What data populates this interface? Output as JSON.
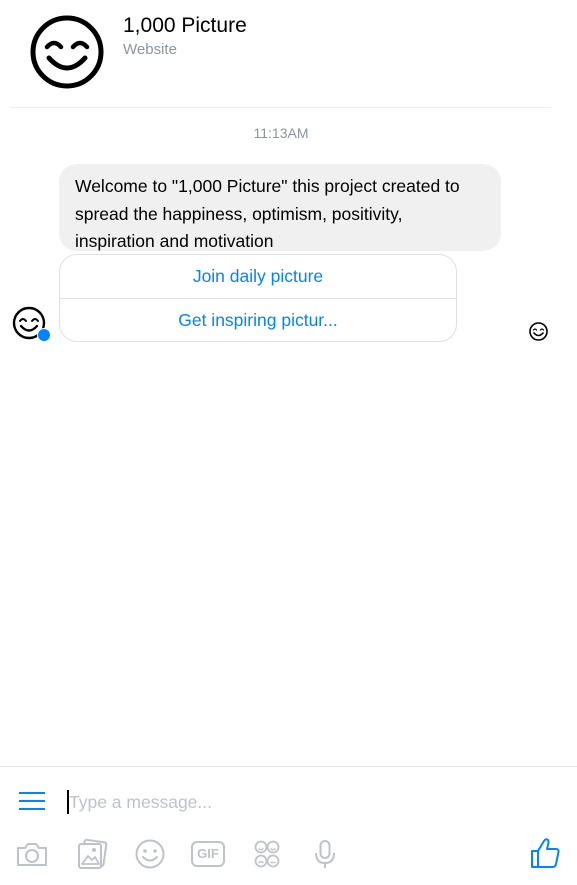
{
  "header": {
    "title": "1,000 Picture",
    "subtitle": "Website",
    "avatar_icon": "smiley-face-icon"
  },
  "conversation": {
    "timestamp": "11:13AM",
    "message": {
      "text": "Welcome to \"1,000 Picture\" this project created to spread the happiness, optimism, positivity, inspiration and motivation"
    },
    "quick_replies": [
      {
        "label": "Join daily picture"
      },
      {
        "label": "Get inspiring pictur..."
      }
    ]
  },
  "composer": {
    "placeholder": "Type a message...",
    "value": "",
    "tools": [
      "camera-icon",
      "gallery-icon",
      "emoji-icon",
      "gif-icon",
      "stickers-icon",
      "microphone-icon"
    ],
    "gif_label": "GIF",
    "send_icon": "thumbs-up-icon"
  },
  "colors": {
    "accent": "#0084ff",
    "bubble": "#f1f0f0",
    "muted_text": "#8d949e",
    "tool_gray": "#bec3c9"
  }
}
